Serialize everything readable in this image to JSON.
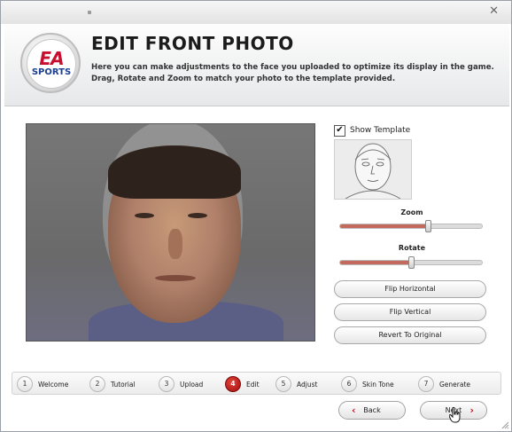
{
  "window": {
    "title_bar_text": ""
  },
  "header": {
    "logo": {
      "line1": "EA",
      "line2": "SPORTS",
      "brand_red": "#c8102e",
      "brand_blue": "#1d3f8f"
    },
    "title": "EDIT FRONT PHOTO",
    "description": "Here you can make adjustments to the face you uploaded to optimize its display in the game. Drag, Rotate and Zoom to match your photo to the template provided."
  },
  "controls": {
    "show_template": {
      "label": "Show Template",
      "checked": true,
      "check_glyph": "✔"
    },
    "zoom": {
      "label": "Zoom",
      "value": 0.62
    },
    "rotate": {
      "label": "Rotate",
      "value": 0.5
    },
    "buttons": {
      "flip_horizontal": "Flip Horizontal",
      "flip_vertical": "Flip Vertical",
      "revert": "Revert To Original"
    }
  },
  "steps": [
    {
      "num": "1",
      "label": "Welcome",
      "active": false
    },
    {
      "num": "2",
      "label": "Tutorial",
      "active": false
    },
    {
      "num": "3",
      "label": "Upload",
      "active": false
    },
    {
      "num": "4",
      "label": "Edit",
      "active": true
    },
    {
      "num": "5",
      "label": "Adjust",
      "active": false
    },
    {
      "num": "6",
      "label": "Skin Tone",
      "active": false
    },
    {
      "num": "7",
      "label": "Generate",
      "active": false
    }
  ],
  "nav": {
    "back_label": "Back",
    "next_label": "Next",
    "back_chevron": "‹",
    "next_chevron": "›",
    "accent": "#c0151b"
  },
  "icons": {
    "close": "close-icon",
    "check": "check-icon",
    "pointer": "hand-pointer-icon",
    "resize": "resize-grip-icon"
  }
}
